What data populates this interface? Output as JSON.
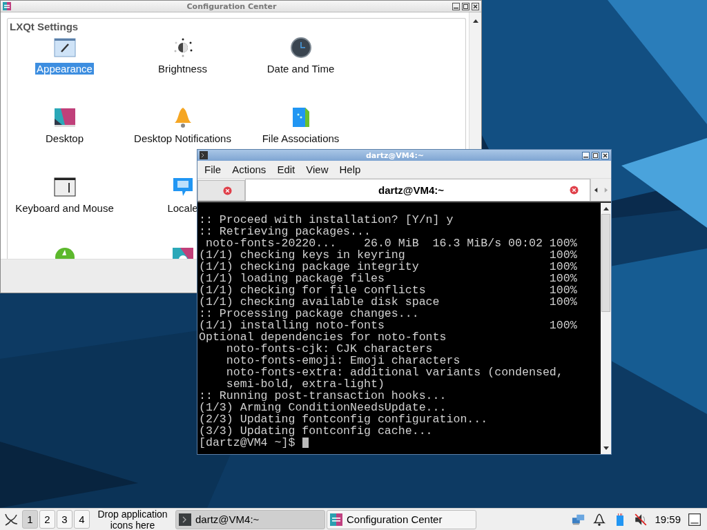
{
  "config_window": {
    "title": "Configuration Center",
    "heading": "LXQt Settings",
    "rows": [
      [
        {
          "label": "Appearance",
          "selected": true
        },
        {
          "label": "Brightness",
          "selected": false
        },
        {
          "label": "Date and Time",
          "selected": false
        }
      ],
      [
        {
          "label": "Desktop",
          "selected": false
        },
        {
          "label": "Desktop Notifications",
          "selected": false
        },
        {
          "label": "File Associations",
          "selected": false
        }
      ],
      [
        {
          "label": "Keyboard and Mouse",
          "selected": false
        },
        {
          "label": "Locale",
          "selected": false
        }
      ],
      [
        {
          "selected": false
        },
        {
          "selected": false
        }
      ]
    ]
  },
  "terminal_window": {
    "title": "dartz@VM4:~",
    "menu": [
      "File",
      "Actions",
      "Edit",
      "View",
      "Help"
    ],
    "tabs": [
      {
        "selected": false
      },
      {
        "label": "dartz@VM4:~",
        "selected": true
      }
    ],
    "lines": [
      ":: Proceed with installation? [Y/n] y",
      ":: Retrieving packages...",
      " noto-fonts-20220...    26.0 MiB  16.3 MiB/s 00:02 100%",
      "(1/1) checking keys in keyring                     100%",
      "(1/1) checking package integrity                   100%",
      "(1/1) loading package files                        100%",
      "(1/1) checking for file conflicts                  100%",
      "(1/1) checking available disk space                100%",
      ":: Processing package changes...",
      "(1/1) installing noto-fonts                        100%",
      "Optional dependencies for noto-fonts",
      "    noto-fonts-cjk: CJK characters",
      "    noto-fonts-emoji: Emoji characters",
      "    noto-fonts-extra: additional variants (condensed,",
      "    semi-bold, extra-light)",
      ":: Running post-transaction hooks...",
      "(1/3) Arming ConditionNeedsUpdate...",
      "(2/3) Updating fontconfig configuration...",
      "(3/3) Updating fontconfig cache...",
      "[dartz@VM4 ~]$"
    ]
  },
  "taskbar": {
    "desktops": [
      {
        "label": "1",
        "selected": true
      },
      {
        "label": "2",
        "selected": false
      },
      {
        "label": "3",
        "selected": false
      },
      {
        "label": "4",
        "selected": false
      }
    ],
    "drop_hint": "Drop application icons here",
    "tasks": [
      {
        "label": "dartz@VM4:~",
        "selected": true
      },
      {
        "label": "Configuration Center",
        "selected": false
      }
    ],
    "clock": "19:59"
  }
}
